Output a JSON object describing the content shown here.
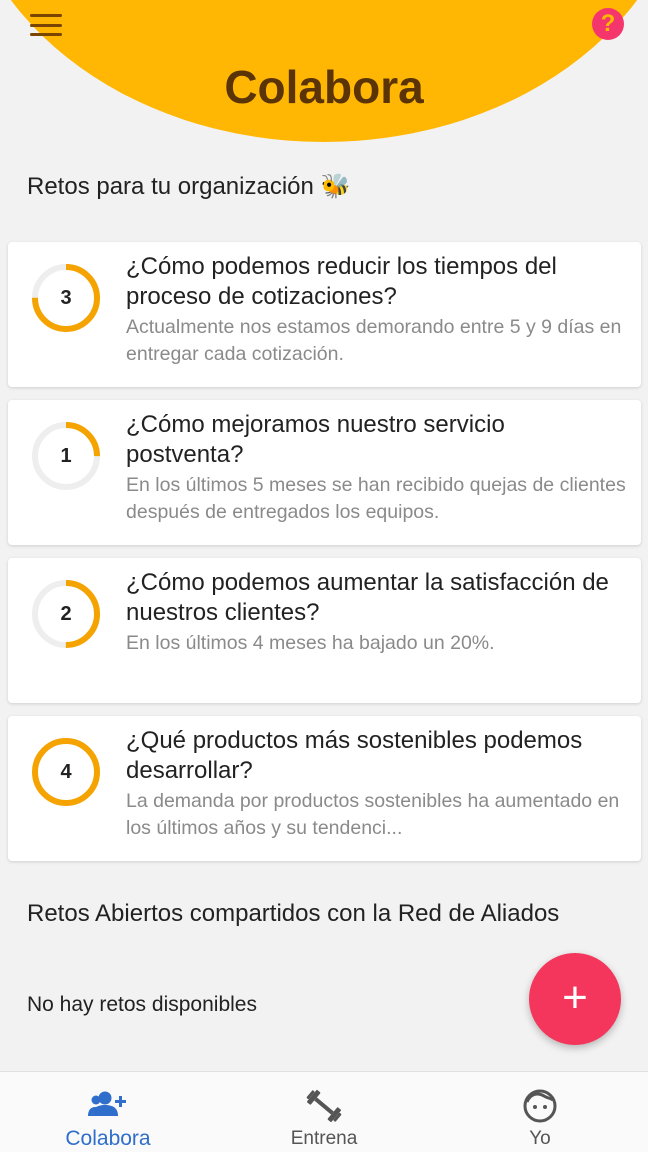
{
  "header": {
    "title": "Colabora",
    "help_label": "?"
  },
  "sections": {
    "org_title": "Retos para tu organización",
    "org_emoji": "🐝",
    "open_title": "Retos Abiertos compartidos con la Red de Aliados",
    "open_empty": "No hay retos disponibles"
  },
  "challenges": [
    {
      "number": "3",
      "progress": 0.75,
      "title": "¿Cómo podemos reducir los tiempos del proceso de cotizaciones?",
      "description": "Actualmente nos estamos demorando entre 5 y 9 días en entregar cada cotización."
    },
    {
      "number": "1",
      "progress": 0.25,
      "title": "¿Cómo mejoramos nuestro servicio postventa?",
      "description": "En los últimos 5 meses se han recibido quejas de clientes después de entregados los equipos."
    },
    {
      "number": "2",
      "progress": 0.5,
      "title": "¿Cómo podemos aumentar la satisfacción de nuestros clientes?",
      "description": "En los últimos 4 meses ha bajado un 20%."
    },
    {
      "number": "4",
      "progress": 1.0,
      "title": "¿Qué productos más sostenibles podemos desarrollar?",
      "description": "La demanda por productos sostenibles ha aumentado en los últimos años y su tendenci..."
    }
  ],
  "fab": {
    "label": "+"
  },
  "nav": {
    "items": [
      {
        "label": "Colabora",
        "icon": "add-user-icon",
        "active": true
      },
      {
        "label": "Entrena",
        "icon": "dumbbell-icon",
        "active": false
      },
      {
        "label": "Yo",
        "icon": "face-icon",
        "active": false
      }
    ]
  },
  "colors": {
    "primary": "#ffb703",
    "ring_progress": "#f5a300",
    "ring_track": "#eeeeee",
    "accent": "#f5365c",
    "nav_active": "#2f6ecb"
  }
}
